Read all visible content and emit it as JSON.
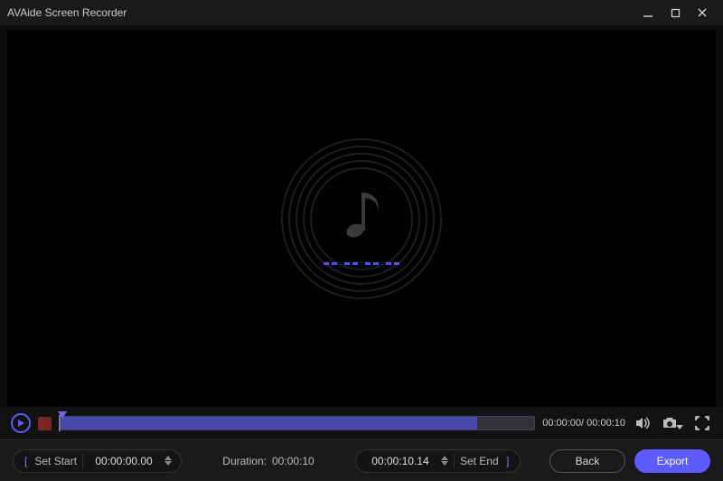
{
  "title": "AVAide Screen Recorder",
  "timeline": {
    "current": "00:00:00",
    "total": "00:00:10",
    "progress_pct": 88
  },
  "clip": {
    "set_start_label": "Set Start",
    "start_time": "00:00:00.00",
    "duration_label": "Duration:",
    "duration_value": "00:00:10",
    "end_time": "00:00:10.14",
    "set_end_label": "Set End"
  },
  "buttons": {
    "back": "Back",
    "export": "Export"
  }
}
